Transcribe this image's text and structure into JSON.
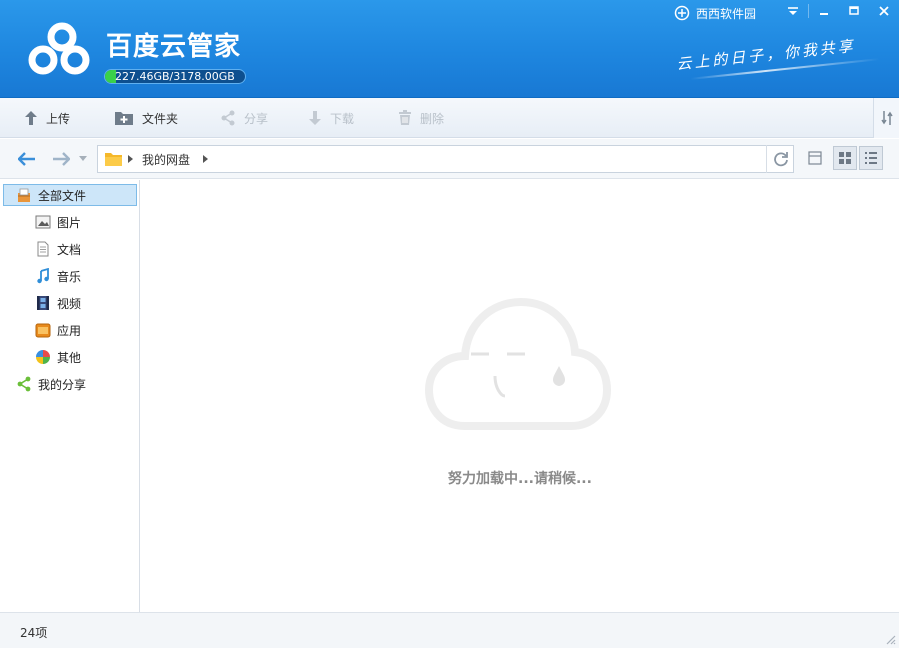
{
  "window": {
    "brand": "西西软件园",
    "controls": [
      "menu",
      "minimize",
      "maximize",
      "close"
    ]
  },
  "header": {
    "title": "百度云管家",
    "storage_text": "227.46GB/3178.00GB",
    "storage_used_fraction": 0.0716,
    "slogan": "云上的日子，你我共享"
  },
  "toolbar": {
    "upload": "上传",
    "folder": "文件夹",
    "share": "分享",
    "download": "下载",
    "delete": "删除"
  },
  "addressbar": {
    "path_label": "我的网盘"
  },
  "sidebar": {
    "items": [
      {
        "label": "全部文件",
        "icon": "all-files-icon",
        "active": true
      },
      {
        "label": "图片",
        "icon": "picture-icon"
      },
      {
        "label": "文档",
        "icon": "document-icon"
      },
      {
        "label": "音乐",
        "icon": "music-icon"
      },
      {
        "label": "视频",
        "icon": "video-icon"
      },
      {
        "label": "应用",
        "icon": "app-icon"
      },
      {
        "label": "其他",
        "icon": "other-icon"
      },
      {
        "label": "我的分享",
        "icon": "share-icon"
      }
    ]
  },
  "main": {
    "loading_text": "努力加载中...请稍候..."
  },
  "status": {
    "count": "24项"
  },
  "colors": {
    "header_blue": "#1e86df",
    "storage_green": "#3ad14a",
    "active_item": "#cde6f9"
  }
}
